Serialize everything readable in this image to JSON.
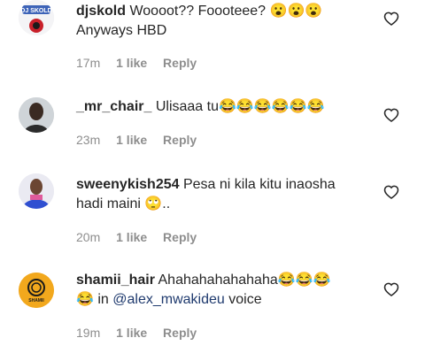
{
  "comments": [
    {
      "username": "djskold",
      "text": "Woooot?? Foooteee? 😮😮😮",
      "text_line2": "Anyways HBD",
      "time": "17m",
      "likes": "1 like",
      "reply": "Reply",
      "avatar_text": "DJ SKOLD"
    },
    {
      "username": "_mr_chair_",
      "text": "Ulisaaa tu😂😂😂😂😂😂",
      "time": "23m",
      "likes": "1 like",
      "reply": "Reply"
    },
    {
      "username": "sweenykish254",
      "text": "Pesa ni kila kitu inaosha",
      "text_line2": "hadi maini 🙄..",
      "time": "20m",
      "likes": "1 like",
      "reply": "Reply"
    },
    {
      "username": "shamii_hair",
      "text": "Ahahahahahahaha😂😂😂",
      "text_line2_prefix": "😂 in ",
      "mention": "@alex_mwakideu",
      "text_line2_suffix": " voice",
      "time": "19m",
      "likes": "1 like",
      "reply": "Reply",
      "avatar_text": "SHAMII"
    }
  ],
  "colors": {
    "text": "#262626",
    "meta": "#8e8e8e",
    "mention": "#1f3a6e"
  }
}
